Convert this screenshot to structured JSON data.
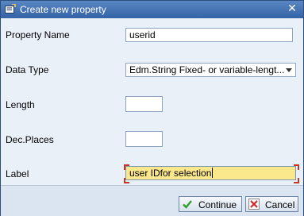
{
  "window": {
    "title": "Create new property",
    "close_icon": "close-icon"
  },
  "fields": {
    "property_name": {
      "label": "Property Name",
      "value": "userid"
    },
    "data_type": {
      "label": "Data Type",
      "value": "Edm.String Fixed- or variable-lengt..."
    },
    "length": {
      "label": "Length",
      "value": ""
    },
    "dec_places": {
      "label": "Dec.Places",
      "value": ""
    },
    "label": {
      "label": "Label",
      "value": "user IDfor selection"
    }
  },
  "buttons": {
    "continue": "Continue",
    "cancel": "Cancel"
  },
  "colors": {
    "title_bar": "#3f6db0",
    "focused_field": "#fbe88c",
    "continue_icon": "#2e9e2e",
    "cancel_icon": "#d02a2a"
  }
}
